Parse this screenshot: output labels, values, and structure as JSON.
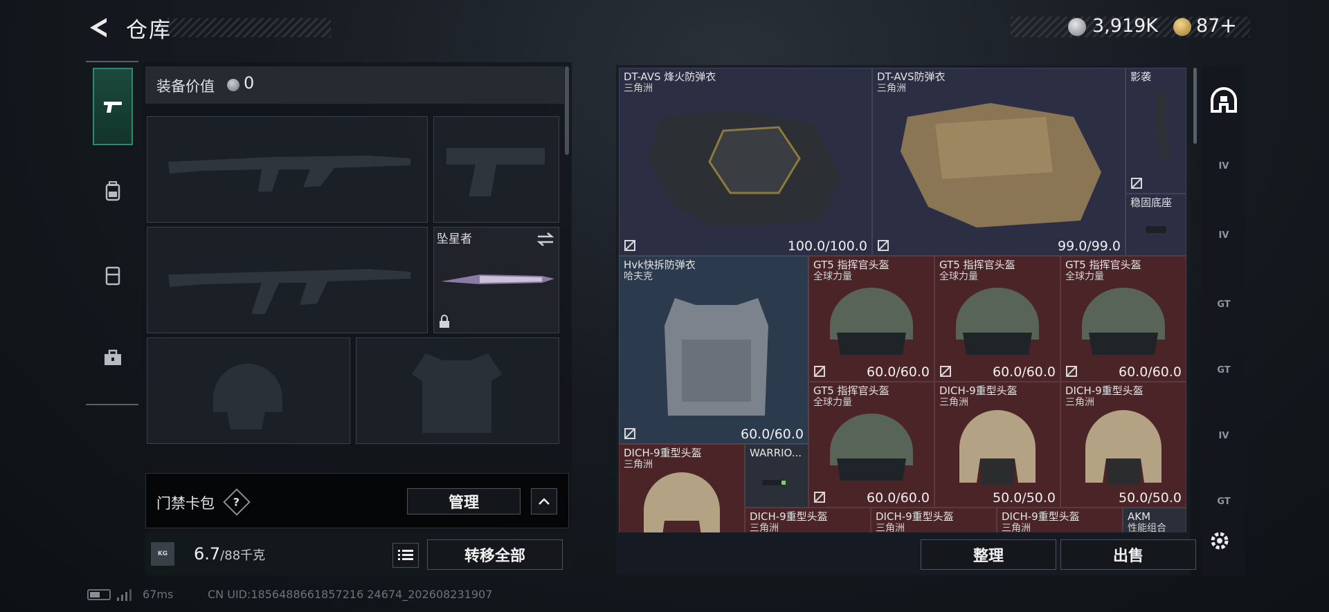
{
  "header": {
    "title": "仓库",
    "back_icon": "back-arrow-icon"
  },
  "currency": {
    "silver": "3,919K",
    "gold": "87",
    "gold_add": "+"
  },
  "rail": {
    "items": [
      {
        "name": "weapon",
        "icon": "pistol-icon",
        "active": true
      },
      {
        "name": "backpack",
        "icon": "backpack-icon",
        "active": false
      },
      {
        "name": "chest-rig",
        "icon": "rig-icon",
        "active": false
      },
      {
        "name": "toolbox",
        "icon": "toolbox-icon",
        "active": false
      }
    ]
  },
  "loadout": {
    "value_label": "装备价值",
    "value": "0",
    "melee_name": "坠星者",
    "keycard_label": "门禁卡包",
    "help": "?",
    "manage_label": "管理",
    "weight": "6.7",
    "weight_max": "/88千克",
    "weight_icon_text": "KG",
    "transfer_label": "转移全部"
  },
  "stash": {
    "items": [
      {
        "name": "DT-AVS 烽火防弹衣",
        "sub": "三角洲",
        "durability": "100.0/100.0",
        "rarity": "purple"
      },
      {
        "name": "DT-AVS防弹衣",
        "sub": "三角洲",
        "durability": "99.0/99.0",
        "rarity": "purple"
      },
      {
        "name": "影袭",
        "sub": "",
        "durability": "",
        "rarity": "purple"
      },
      {
        "name": "稳固底座",
        "sub": "",
        "durability": "",
        "rarity": "purple"
      },
      {
        "name": "Hvk快拆防弹衣",
        "sub": "哈夫克",
        "durability": "60.0/60.0",
        "rarity": "blue"
      },
      {
        "name": "GT5 指挥官头盔",
        "sub": "全球力量",
        "durability": "60.0/60.0",
        "rarity": "red"
      },
      {
        "name": "GT5 指挥官头盔",
        "sub": "全球力量",
        "durability": "60.0/60.0",
        "rarity": "red"
      },
      {
        "name": "GT5 指挥官头盔",
        "sub": "全球力量",
        "durability": "60.0/60.0",
        "rarity": "red"
      },
      {
        "name": "GT5 指挥官头盔",
        "sub": "全球力量",
        "durability": "60.0/60.0",
        "rarity": "red"
      },
      {
        "name": "DICH-9重型头盔",
        "sub": "三角洲",
        "durability": "50.0/50.0",
        "rarity": "red"
      },
      {
        "name": "DICH-9重型头盔",
        "sub": "三角洲",
        "durability": "50.0/50.0",
        "rarity": "red"
      },
      {
        "name": "DICH-9重型头盔",
        "sub": "三角洲",
        "durability": "",
        "rarity": "red"
      },
      {
        "name": "WARRIO...",
        "sub": "",
        "durability": "",
        "rarity": "gray"
      },
      {
        "name": "DICH-9重型头盔",
        "sub": "三角洲",
        "durability": "",
        "rarity": "red"
      },
      {
        "name": "DICH-9重型头盔",
        "sub": "三角洲",
        "durability": "",
        "rarity": "red"
      },
      {
        "name": "DICH-9重型头盔",
        "sub": "三角洲",
        "durability": "",
        "rarity": "red"
      },
      {
        "name": "AKM",
        "sub": "性能组合",
        "durability": "",
        "rarity": "gray"
      }
    ],
    "sort_label": "整理",
    "sell_label": "出售"
  },
  "right_rail": {
    "tabs": [
      {
        "icon": "stash-home-icon",
        "label": ""
      },
      {
        "icon": "stash-page-icon",
        "label": "IV"
      },
      {
        "icon": "stash-page-icon",
        "label": "IV"
      },
      {
        "icon": "stash-page-icon",
        "label": "GT"
      },
      {
        "icon": "stash-page-icon",
        "label": "GT"
      },
      {
        "icon": "stash-page-icon",
        "label": "IV"
      },
      {
        "icon": "stash-page-icon",
        "label": "GT"
      }
    ],
    "settings_icon": "gear-icon"
  },
  "footer": {
    "ping": "67ms",
    "uid": "CN UID:1856488661857216 24674_202608231907"
  },
  "colors": {
    "accent_green": "#2e8a6b",
    "rarity_red": "#4b2428",
    "rarity_purple": "#2c2e44",
    "rarity_blue": "#2b3a4d"
  }
}
